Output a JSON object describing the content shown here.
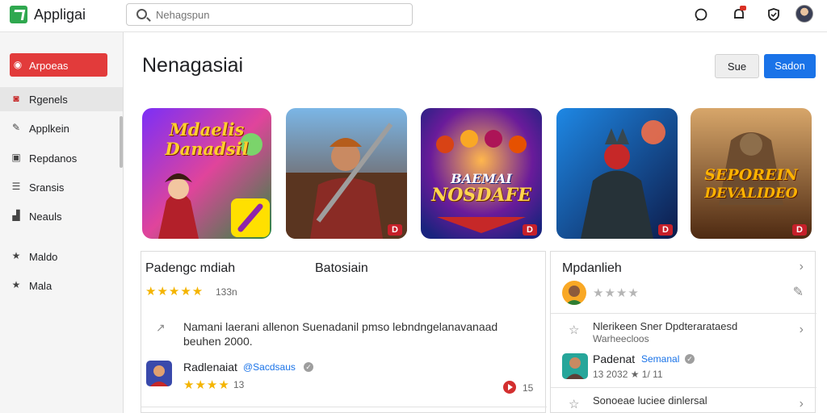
{
  "app": {
    "name": "Appligai",
    "logo_icon": "app-logo-icon"
  },
  "search": {
    "placeholder": "Nehagspun"
  },
  "topbar_icons": [
    "chat-icon",
    "notification-icon",
    "shield-icon",
    "avatar"
  ],
  "sidebar": {
    "items": [
      {
        "label": "Arpoeas",
        "icon": "tag-icon",
        "style": "primary"
      },
      {
        "label": "Rgenels",
        "icon": "game-controller-icon",
        "style": "selected"
      },
      {
        "label": "Applkein",
        "icon": "edit-icon",
        "style": "normal"
      },
      {
        "label": "Repdanos",
        "icon": "image-icon",
        "style": "normal"
      },
      {
        "label": "Sransis",
        "icon": "list-icon",
        "style": "normal"
      },
      {
        "label": "Neauls",
        "icon": "chart-icon",
        "style": "normal"
      },
      {
        "label": "Maldo",
        "icon": "star-icon",
        "style": "normal"
      },
      {
        "label": "Mala",
        "icon": "star-icon",
        "style": "normal"
      }
    ]
  },
  "header": {
    "title": "Nenagasiai",
    "secondary_button": "Sue",
    "primary_button": "Sadon"
  },
  "tiles": [
    {
      "caption_line1": "Mdaelis",
      "caption_line2": "Danadsil",
      "tag": ""
    },
    {
      "caption_line1": "",
      "caption_line2": "",
      "tag": "D"
    },
    {
      "caption_line1": "BAEMAI",
      "caption_line2": "NOSDAFE",
      "tag": "D"
    },
    {
      "caption_line1": "",
      "caption_line2": "",
      "tag": "D"
    },
    {
      "caption_line1": "SEPOREIN",
      "caption_line2": "DEVALIDEO",
      "tag": "D"
    }
  ],
  "left_panel": {
    "title": "Padengc mdiah",
    "tab2": "Batosiain",
    "rating_stars": "★★★★★",
    "rating_count": "133n",
    "description": "Namani laerani allenon Suenadanil pmso lebndngelanavanaad beuhen 2000.",
    "developer_name": "Radlenaiat",
    "developer_handle": "@Sacdsaus",
    "verified_mark": "✓",
    "dev_stars": "★★★★",
    "dev_count": "13",
    "play_count": "15"
  },
  "right_panel": {
    "title": "Mpdanlieh",
    "rows": [
      {
        "text": "",
        "stars": "★★★★",
        "sub": ""
      },
      {
        "text": "Nlerikeen Sner Dpdterarataesd",
        "sub": "Warheecloos"
      },
      {
        "text": "Padenat",
        "handle": "Semanal",
        "sub": "13 2032 ★ 1/ 11"
      },
      {
        "text": "Sonoeae luciee dinlersal",
        "sub": ""
      }
    ]
  }
}
